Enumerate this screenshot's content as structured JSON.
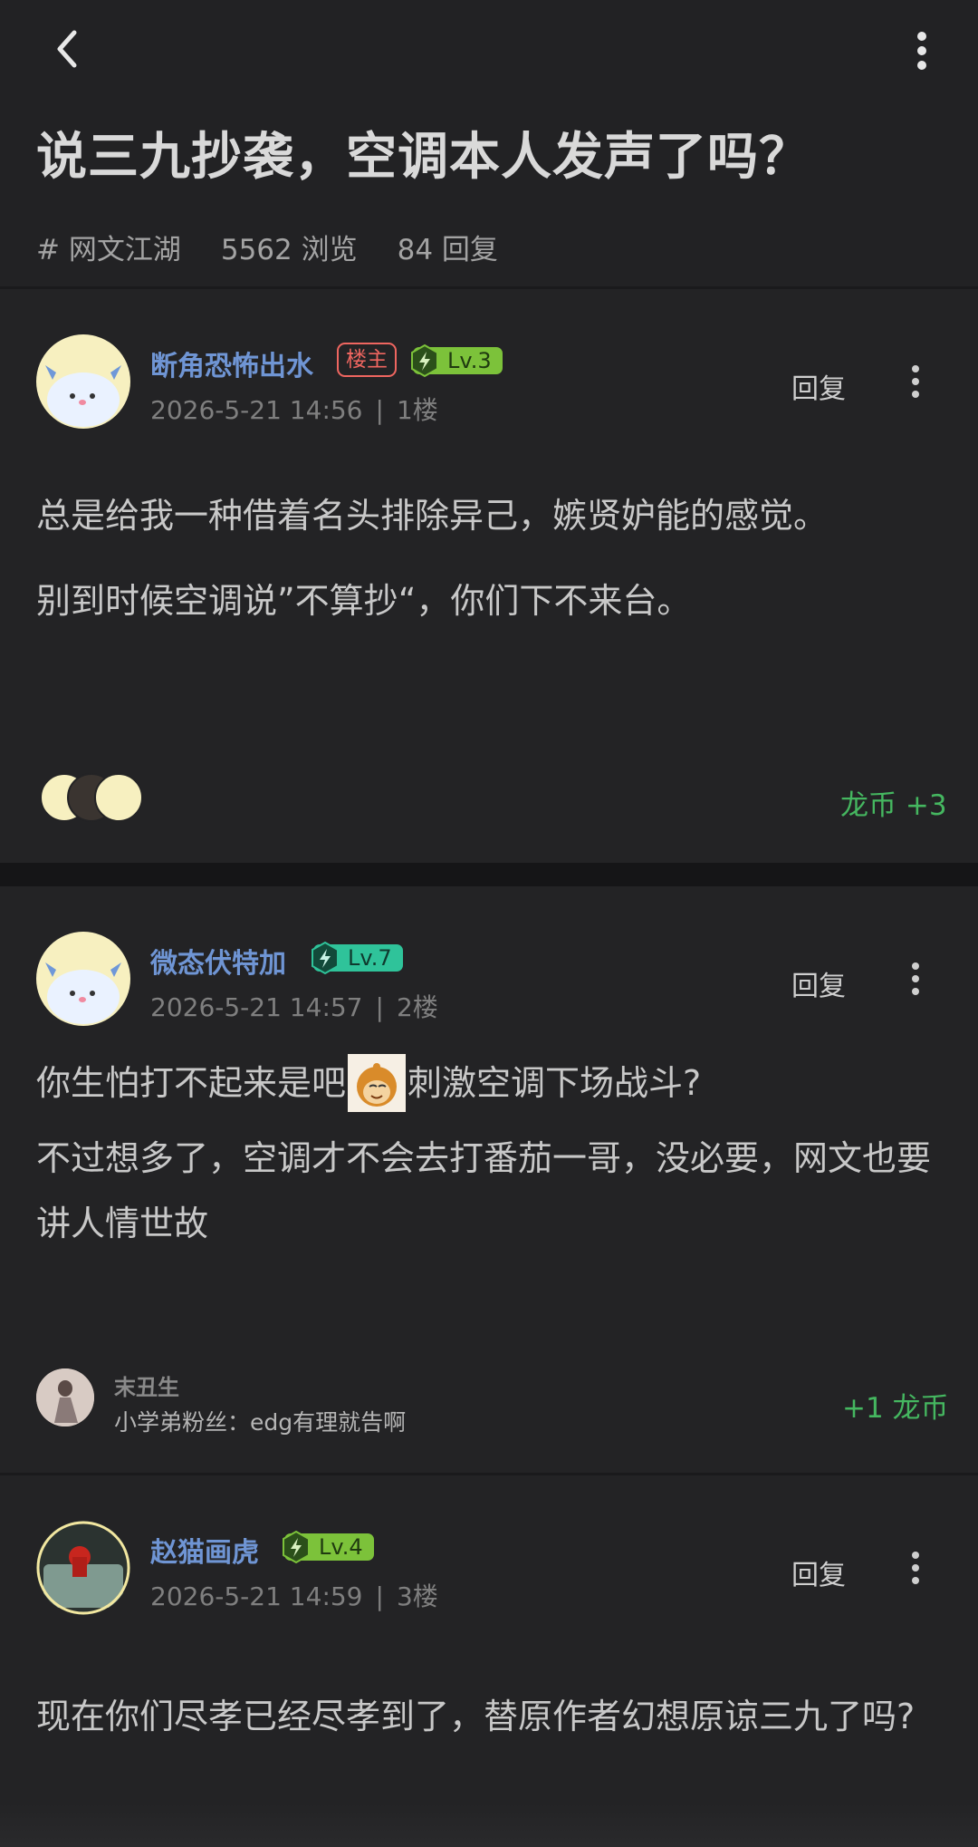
{
  "header": {
    "title": "说三九抄袭，空调本人发声了吗？",
    "tag": "# 网文江湖",
    "views": "5562 浏览",
    "replies": "84 回复"
  },
  "posts": [
    {
      "username": "断角恐怖出水",
      "host_badge": "楼主",
      "level": "Lv.3",
      "level_color": "#7cc23a",
      "date": "2026-5-21 14:56",
      "floor": "1楼",
      "reply": "回复",
      "lines": [
        "总是给我一种借着名头排除异己，嫉贤妒能的感觉。",
        "别到时候空调说”不算抄“，你们下不来台。"
      ],
      "reward": "龙币 +3"
    },
    {
      "username": "微态伏特加",
      "level": "Lv.7",
      "level_color": "#2fc39a",
      "date": "2026-5-21 14:57",
      "floor": "2楼",
      "reply": "回复",
      "line1_a": "你生怕打不起来是吧",
      "line1_b": "刺激空调下场战斗?",
      "line2": "不过想多了，空调才不会去打番茄一哥，没必要，网文也要讲人情世故",
      "sub_reply": {
        "name": "末丑生",
        "text": "小学弟粉丝：edg有理就告啊"
      },
      "reward": "+1 龙币"
    },
    {
      "username": "赵猫画虎",
      "level": "Lv.4",
      "level_color": "#7cc23a",
      "date": "2026-5-21 14:59",
      "floor": "3楼",
      "reply": "回复",
      "line1": "现在你们尽孝已经尽孝到了，替原作者幻想原谅三九了吗?"
    }
  ],
  "colors": {
    "accent_blue": "#6f95d4",
    "reward_green": "#45b760",
    "host_red": "#ef6660"
  }
}
